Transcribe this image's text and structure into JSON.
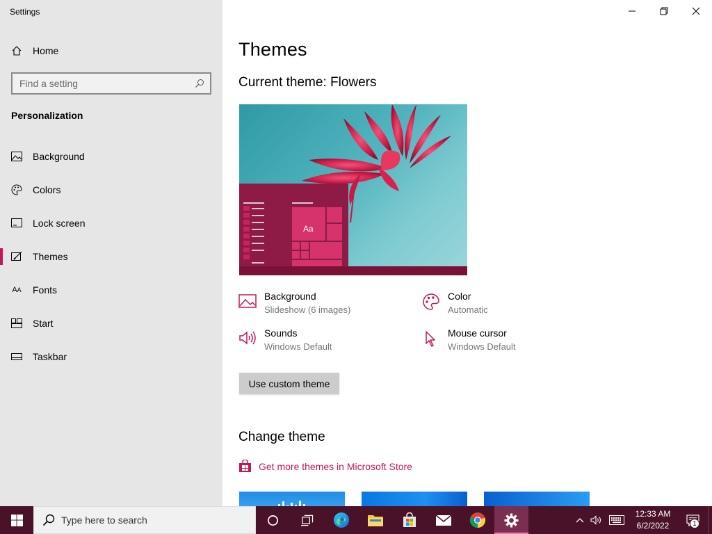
{
  "window": {
    "title": "Settings",
    "minimize_glyph": "minimize-icon",
    "maximize_glyph": "restore-icon",
    "close_glyph": "close-icon"
  },
  "sidebar": {
    "home_label": "Home",
    "search_placeholder": "Find a setting",
    "section_title": "Personalization",
    "items": [
      {
        "label": "Background",
        "icon": "picture-icon",
        "active": false
      },
      {
        "label": "Colors",
        "icon": "palette-icon",
        "active": false
      },
      {
        "label": "Lock screen",
        "icon": "lock-screen-icon",
        "active": false
      },
      {
        "label": "Themes",
        "icon": "themes-icon",
        "active": true
      },
      {
        "label": "Fonts",
        "icon": "fonts-icon",
        "active": false
      },
      {
        "label": "Start",
        "icon": "start-icon",
        "active": false
      },
      {
        "label": "Taskbar",
        "icon": "taskbar-icon",
        "active": false
      }
    ]
  },
  "main": {
    "page_title": "Themes",
    "current_theme": "Current theme: Flowers",
    "preview_sample_text": "Aa",
    "properties": {
      "background": {
        "title": "Background",
        "value": "Slideshow (6 images)"
      },
      "color": {
        "title": "Color",
        "value": "Automatic"
      },
      "sounds": {
        "title": "Sounds",
        "value": "Windows Default"
      },
      "mouse_cursor": {
        "title": "Mouse cursor",
        "value": "Windows Default"
      }
    },
    "use_custom_button": "Use custom theme",
    "change_theme_title": "Change theme",
    "store_link": "Get more themes in Microsoft Store"
  },
  "taskbar": {
    "search_placeholder": "Type here to search",
    "apps": [
      "cortana-icon",
      "task-view-icon",
      "edge-icon",
      "file-explorer-icon",
      "store-icon",
      "mail-icon",
      "chrome-icon",
      "settings-icon"
    ],
    "time": "12:33 AM",
    "date": "6/2/2022",
    "notification_count": "1"
  },
  "colors": {
    "accent": "#c2185b",
    "taskbar": "#4a1228",
    "sidebar": "#e6e6e6"
  }
}
